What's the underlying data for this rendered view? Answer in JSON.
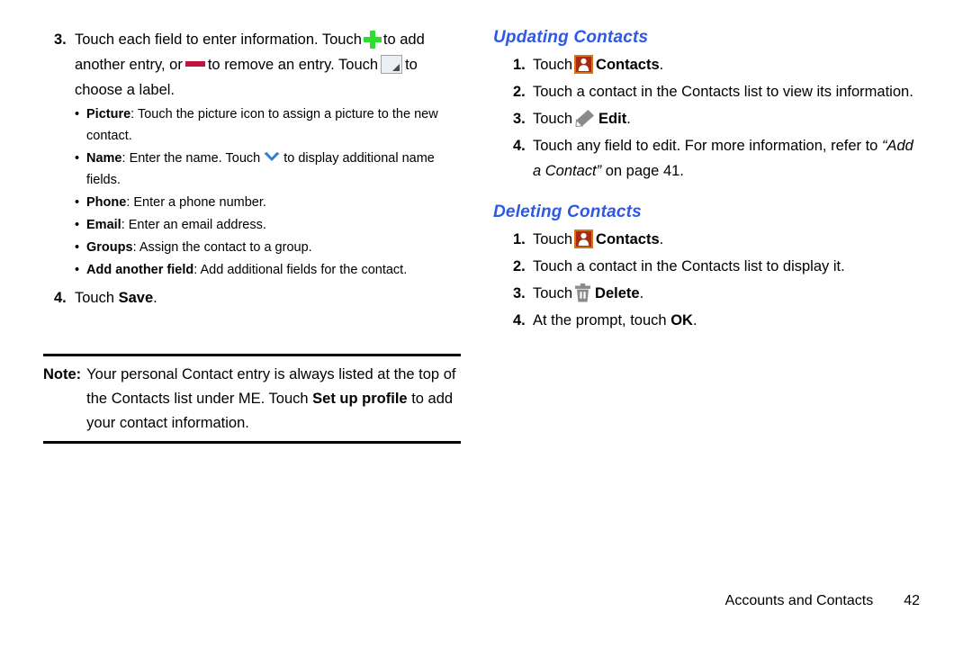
{
  "document": {
    "page_number": "42",
    "footer_section": "Accounts and Contacts"
  },
  "left_column": {
    "step3": {
      "number": "3.",
      "text_part1": "Touch each field to enter information. Touch",
      "icon_add": "plus-icon",
      "text_part2": "to add another entry, or",
      "icon_remove": "minus-icon",
      "text_part3": "to remove an entry. Touch",
      "icon_label": "dropdown-box-icon",
      "text_part4": "to choose a label."
    },
    "bullets": [
      {
        "term": "Picture",
        "separator": ": ",
        "description": "Touch the picture icon to assign a picture to the new contact."
      },
      {
        "term": "Name",
        "separator": ": ",
        "description_before_icon": "Enter the name. Touch",
        "icon": "chevron-down-icon",
        "description_after_icon": "to display additional name fields."
      },
      {
        "term": "Phone",
        "separator": ": ",
        "description": "Enter a phone number."
      },
      {
        "term": "Email",
        "separator": ": ",
        "description": "Enter an email address."
      },
      {
        "term": "Groups",
        "separator": ": ",
        "description": "Assign the contact to a group."
      },
      {
        "term": "Add another field",
        "separator": ": ",
        "description": "Add additional fields for the contact."
      }
    ],
    "step4": {
      "number": "4.",
      "text_before": "Touch",
      "bold_term": "Save",
      "text_after": "."
    },
    "note": {
      "label": "Note:",
      "text_part1": "Your personal Contact entry is always listed at the top of the Contacts list under ME. Touch",
      "bold_term": "Set up profile",
      "text_part2": "to add your contact information."
    }
  },
  "right_column": {
    "section_updating": {
      "heading": "Updating Contacts",
      "steps": [
        {
          "number": "1.",
          "text_before": "Touch",
          "icon": "contacts-app-icon",
          "bold_term": "Contacts",
          "text_after": "."
        },
        {
          "number": "2.",
          "text": "Touch a contact in the Contacts list to view its information."
        },
        {
          "number": "3.",
          "text_before": "Touch",
          "icon": "edit-pencil-icon",
          "bold_term": "Edit",
          "text_after": "."
        },
        {
          "number": "4.",
          "text_before": "Touch any field to edit. For more information, refer to",
          "italic_ref": "“Add a Contact”",
          "text_after": "on page 41."
        }
      ]
    },
    "section_deleting": {
      "heading": "Deleting Contacts",
      "steps": [
        {
          "number": "1.",
          "text_before": "Touch",
          "icon": "contacts-app-icon",
          "bold_term": "Contacts",
          "text_after": "."
        },
        {
          "number": "2.",
          "text": "Touch a contact in the Contacts list to display it."
        },
        {
          "number": "3.",
          "text_before": "Touch",
          "icon": "trash-delete-icon",
          "bold_term": "Delete",
          "text_after": "."
        },
        {
          "number": "4.",
          "text_before": "At the prompt, touch",
          "bold_term": "OK",
          "text_after": "."
        }
      ]
    }
  },
  "colors": {
    "heading_blue": "#2d58e8",
    "plus_green": "#2fdd2f",
    "minus_red": "#c2143c",
    "chevron_blue": "#2f7fd8",
    "contacts_icon_bg": "#a82a10",
    "contacts_icon_border": "#d4731a",
    "gray_icon": "#8a8a8a"
  }
}
